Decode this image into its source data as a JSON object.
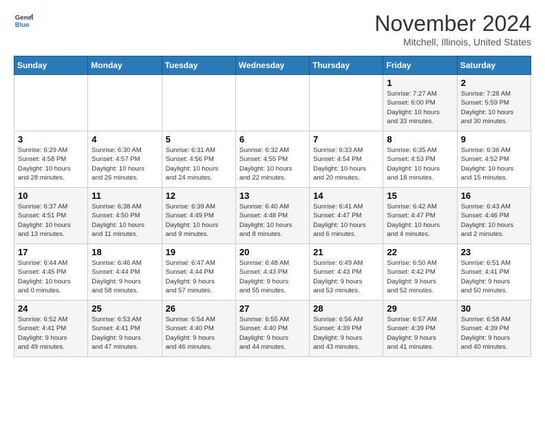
{
  "logo": {
    "line1": "General",
    "line2": "Blue"
  },
  "title": "November 2024",
  "location": "Mitchell, Illinois, United States",
  "days_of_week": [
    "Sunday",
    "Monday",
    "Tuesday",
    "Wednesday",
    "Thursday",
    "Friday",
    "Saturday"
  ],
  "weeks": [
    [
      {
        "day": "",
        "info": ""
      },
      {
        "day": "",
        "info": ""
      },
      {
        "day": "",
        "info": ""
      },
      {
        "day": "",
        "info": ""
      },
      {
        "day": "",
        "info": ""
      },
      {
        "day": "1",
        "info": "Sunrise: 7:27 AM\nSunset: 6:00 PM\nDaylight: 10 hours\nand 33 minutes."
      },
      {
        "day": "2",
        "info": "Sunrise: 7:28 AM\nSunset: 5:59 PM\nDaylight: 10 hours\nand 30 minutes."
      }
    ],
    [
      {
        "day": "3",
        "info": "Sunrise: 6:29 AM\nSunset: 4:58 PM\nDaylight: 10 hours\nand 28 minutes."
      },
      {
        "day": "4",
        "info": "Sunrise: 6:30 AM\nSunset: 4:57 PM\nDaylight: 10 hours\nand 26 minutes."
      },
      {
        "day": "5",
        "info": "Sunrise: 6:31 AM\nSunset: 4:56 PM\nDaylight: 10 hours\nand 24 minutes."
      },
      {
        "day": "6",
        "info": "Sunrise: 6:32 AM\nSunset: 4:55 PM\nDaylight: 10 hours\nand 22 minutes."
      },
      {
        "day": "7",
        "info": "Sunrise: 6:33 AM\nSunset: 4:54 PM\nDaylight: 10 hours\nand 20 minutes."
      },
      {
        "day": "8",
        "info": "Sunrise: 6:35 AM\nSunset: 4:53 PM\nDaylight: 10 hours\nand 18 minutes."
      },
      {
        "day": "9",
        "info": "Sunrise: 6:36 AM\nSunset: 4:52 PM\nDaylight: 10 hours\nand 15 minutes."
      }
    ],
    [
      {
        "day": "10",
        "info": "Sunrise: 6:37 AM\nSunset: 4:51 PM\nDaylight: 10 hours\nand 13 minutes."
      },
      {
        "day": "11",
        "info": "Sunrise: 6:38 AM\nSunset: 4:50 PM\nDaylight: 10 hours\nand 11 minutes."
      },
      {
        "day": "12",
        "info": "Sunrise: 6:39 AM\nSunset: 4:49 PM\nDaylight: 10 hours\nand 9 minutes."
      },
      {
        "day": "13",
        "info": "Sunrise: 6:40 AM\nSunset: 4:48 PM\nDaylight: 10 hours\nand 8 minutes."
      },
      {
        "day": "14",
        "info": "Sunrise: 6:41 AM\nSunset: 4:47 PM\nDaylight: 10 hours\nand 6 minutes."
      },
      {
        "day": "15",
        "info": "Sunrise: 6:42 AM\nSunset: 4:47 PM\nDaylight: 10 hours\nand 4 minutes."
      },
      {
        "day": "16",
        "info": "Sunrise: 6:43 AM\nSunset: 4:46 PM\nDaylight: 10 hours\nand 2 minutes."
      }
    ],
    [
      {
        "day": "17",
        "info": "Sunrise: 6:44 AM\nSunset: 4:45 PM\nDaylight: 10 hours\nand 0 minutes."
      },
      {
        "day": "18",
        "info": "Sunrise: 6:46 AM\nSunset: 4:44 PM\nDaylight: 9 hours\nand 58 minutes."
      },
      {
        "day": "19",
        "info": "Sunrise: 6:47 AM\nSunset: 4:44 PM\nDaylight: 9 hours\nand 57 minutes."
      },
      {
        "day": "20",
        "info": "Sunrise: 6:48 AM\nSunset: 4:43 PM\nDaylight: 9 hours\nand 55 minutes."
      },
      {
        "day": "21",
        "info": "Sunrise: 6:49 AM\nSunset: 4:43 PM\nDaylight: 9 hours\nand 53 minutes."
      },
      {
        "day": "22",
        "info": "Sunrise: 6:50 AM\nSunset: 4:42 PM\nDaylight: 9 hours\nand 52 minutes."
      },
      {
        "day": "23",
        "info": "Sunrise: 6:51 AM\nSunset: 4:41 PM\nDaylight: 9 hours\nand 50 minutes."
      }
    ],
    [
      {
        "day": "24",
        "info": "Sunrise: 6:52 AM\nSunset: 4:41 PM\nDaylight: 9 hours\nand 49 minutes."
      },
      {
        "day": "25",
        "info": "Sunrise: 6:53 AM\nSunset: 4:41 PM\nDaylight: 9 hours\nand 47 minutes."
      },
      {
        "day": "26",
        "info": "Sunrise: 6:54 AM\nSunset: 4:40 PM\nDaylight: 9 hours\nand 46 minutes."
      },
      {
        "day": "27",
        "info": "Sunrise: 6:55 AM\nSunset: 4:40 PM\nDaylight: 9 hours\nand 44 minutes."
      },
      {
        "day": "28",
        "info": "Sunrise: 6:56 AM\nSunset: 4:39 PM\nDaylight: 9 hours\nand 43 minutes."
      },
      {
        "day": "29",
        "info": "Sunrise: 6:57 AM\nSunset: 4:39 PM\nDaylight: 9 hours\nand 41 minutes."
      },
      {
        "day": "30",
        "info": "Sunrise: 6:58 AM\nSunset: 4:39 PM\nDaylight: 9 hours\nand 40 minutes."
      }
    ]
  ]
}
